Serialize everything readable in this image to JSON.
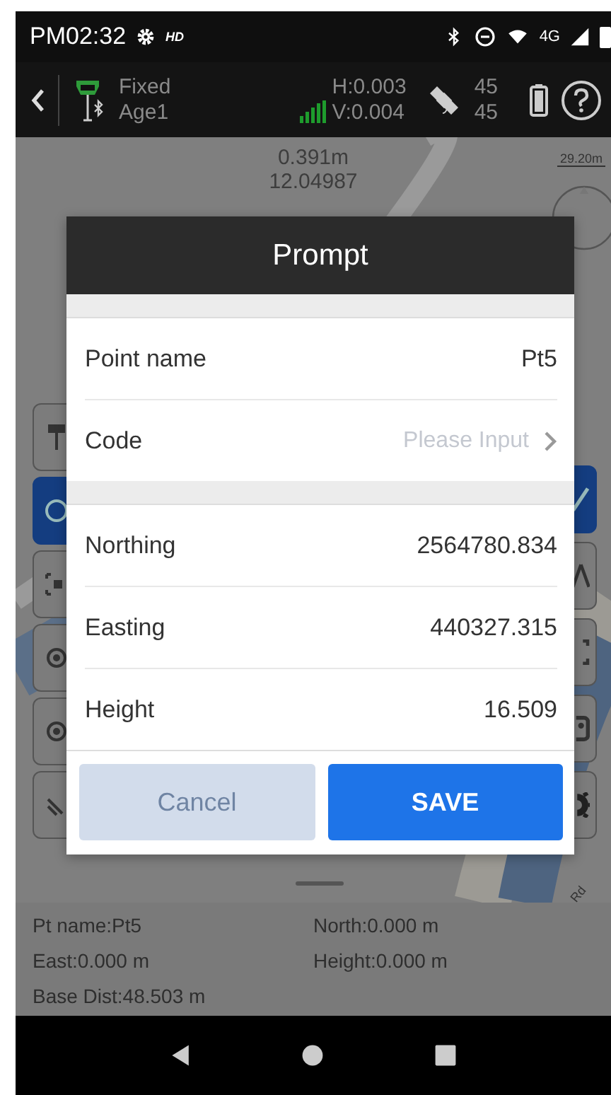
{
  "status_bar": {
    "time": "PM02:32",
    "hd": "HD",
    "network": "4G"
  },
  "toolbar": {
    "solution": "Fixed",
    "age": "Age1",
    "h_precision": "H:0.003",
    "v_precision": "V:0.004",
    "satellites_tracked": "45",
    "satellites_used": "45"
  },
  "map": {
    "distance": "0.391m",
    "value": "12.04987",
    "scale": "29.20m",
    "road_label": "Rd"
  },
  "dialog": {
    "title": "Prompt",
    "sections": [
      [
        {
          "kind": "value",
          "label": "Point name",
          "value": "Pt5"
        },
        {
          "kind": "input",
          "label": "Code",
          "placeholder": "Please Input"
        }
      ],
      [
        {
          "kind": "value",
          "label": "Northing",
          "value": "2564780.834"
        },
        {
          "kind": "value",
          "label": "Easting",
          "value": "440327.315"
        },
        {
          "kind": "value",
          "label": "Height",
          "value": "16.509"
        }
      ]
    ],
    "buttons": [
      {
        "label": "Cancel",
        "disabled": true
      },
      {
        "label": "SAVE",
        "disabled": false
      }
    ]
  },
  "info_panel": [
    {
      "left": "Pt name:Pt5",
      "right": "North:0.000 m"
    },
    {
      "left": "East:0.000 m",
      "right": "Height:0.000 m"
    },
    {
      "left": "Base Dist:48.503 m"
    }
  ]
}
